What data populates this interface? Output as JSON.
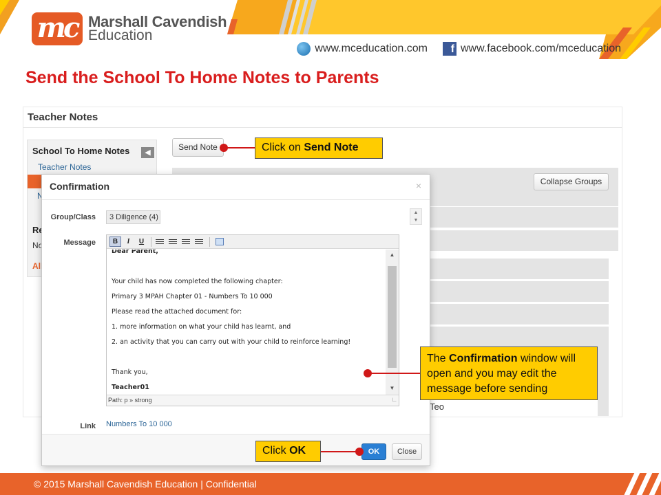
{
  "header": {
    "logo_mark": "mc",
    "logo_line1": "Marshall Cavendish",
    "logo_line2": "Education",
    "website": "www.mceducation.com",
    "facebook": "www.facebook.com/mceducation",
    "web_icon": "globe-icon",
    "fb_icon": "facebook-icon"
  },
  "slide_title": "Send the School To Home Notes to Parents",
  "app": {
    "title": "Teacher Notes",
    "sidebar": {
      "heading": "School To Home Notes",
      "link": "Teacher Notes",
      "truncated_item": "N",
      "section2_heading": "Re",
      "section2_text": "No",
      "section2_link": "All"
    },
    "send_note_button": "Send Note",
    "collapse_groups_button": "Collapse Groups",
    "row_text": "Teo"
  },
  "modal": {
    "title": "Confirmation",
    "close_x": "×",
    "group_label": "Group/Class",
    "group_value": "3 Diligence (4)",
    "message_label": "Message",
    "toolbar": {
      "bold": "B",
      "italic": "I",
      "underline": "U"
    },
    "message_lines": [
      "Dear Parent,",
      "Your child has now completed the following chapter:",
      "Primary 3 MPAH Chapter 01 - Numbers To 10 000",
      "Please read the attached document for:",
      "1. more information on what your child has learnt, and",
      "2. an activity that you can carry out with your child to reinforce learning!",
      "Thank you,",
      "Teacher01"
    ],
    "path": "Path: p » strong",
    "link_label": "Link",
    "link_value": "Numbers To 10 000",
    "ok_button": "OK",
    "close_button": "Close"
  },
  "callouts": {
    "send_note": {
      "prefix": "Click on ",
      "bold": "Send Note"
    },
    "confirmation": {
      "pre": "The ",
      "bold": "Confirmation",
      "post": " window will open and you may edit the message before sending"
    },
    "ok": {
      "prefix": "Click ",
      "bold": "OK"
    }
  },
  "colors": {
    "brand_orange": "#e8632a",
    "title_red": "#d91e1e",
    "callout_yellow": "#ffcc00",
    "ok_blue": "#2a7fd4"
  },
  "footer": "© 2015 Marshall Cavendish Education | Confidential"
}
